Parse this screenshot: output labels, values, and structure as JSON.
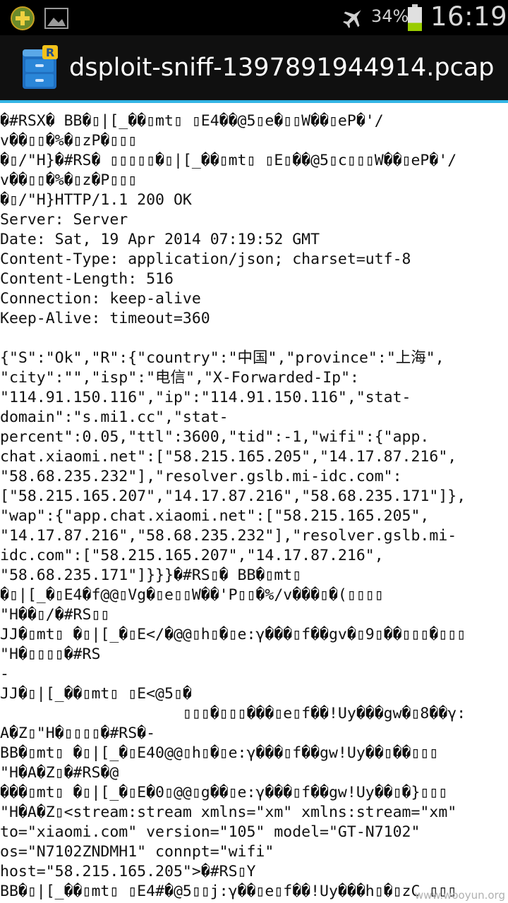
{
  "status_bar": {
    "battery_percent": "34%",
    "battery_level": 0.34,
    "time": "16:19",
    "icons": [
      "add-notification-icon",
      "image-notification-icon",
      "airplane-mode-icon",
      "battery-icon"
    ]
  },
  "title_bar": {
    "app_icon": "file-cabinet-icon",
    "title": "dsploit-sniff-1397891944914.pcap"
  },
  "content": {
    "lines": [
      "�#RSX� BB�▯|[_��▯mt▯ ▯E4��@5▯e�▯▯W��▯eP�'/",
      "v��▯▯�%�▯zP�▯▯▯",
      "�▯/\"H}�#RS� ▯▯▯▯▯�▯|[_��▯mt▯ ▯E▯��@5▯c▯▯▯W��▯eP�'/",
      "v��▯▯�%�▯z�P▯▯▯",
      "�▯/\"H}HTTP/1.1 200 OK",
      "Server: Server",
      "Date: Sat, 19 Apr 2014 07:19:52 GMT",
      "Content-Type: application/json; charset=utf-8",
      "Content-Length: 516",
      "Connection: keep-alive",
      "Keep-Alive: timeout=360",
      "",
      "{\"S\":\"Ok\",\"R\":{\"country\":\"中国\",\"province\":\"上海\",",
      "\"city\":\"\",\"isp\":\"电信\",\"X-Forwarded-Ip\":",
      "\"114.91.150.116\",\"ip\":\"114.91.150.116\",\"stat-",
      "domain\":\"s.mi1.cc\",\"stat-",
      "percent\":0.05,\"ttl\":3600,\"tid\":-1,\"wifi\":{\"app.",
      "chat.xiaomi.net\":[\"58.215.165.205\",\"14.17.87.216\",",
      "\"58.68.235.232\"],\"resolver.gslb.mi-idc.com\":",
      "[\"58.215.165.207\",\"14.17.87.216\",\"58.68.235.171\"]},",
      "\"wap\":{\"app.chat.xiaomi.net\":[\"58.215.165.205\",",
      "\"14.17.87.216\",\"58.68.235.232\"],\"resolver.gslb.mi-",
      "idc.com\":[\"58.215.165.207\",\"14.17.87.216\",",
      "\"58.68.235.171\"]}}}�#RS▯� BB�▯mt▯",
      "�▯|[_�▯E4�f@@▯Vg�▯e▯▯W��'P▯▯�%/v���▯�(▯▯▯▯",
      "\"H��▯/�#RS▯▯",
      "JJ�▯mt▯ �▯|[_�▯E</�@@▯h▯�▯e:γ���▯f��gv�▯9▯��▯▯▯�▯▯▯",
      "\"H�▯▯▯▯�#RS",
      "-",
      "JJ�▯|[_��▯mt▯ ▯E<@5▯�",
      "                    ▯▯▯�▯▯▯���▯e▯f��!Uy���gw�▯8��γ:",
      "A�Z▯\"H�▯▯▯▯�#RS�-",
      "BB�▯mt▯ �▯|[_�▯E40@@▯h▯�▯e:γ���▯f��gw!Uy��▯��▯▯▯",
      "\"H�A�Z▯�#RS�@",
      "���▯mt▯ �▯|[_�▯E�0▯@@▯g��▯e:γ���▯f��gw!Uy��▯�}▯▯▯",
      "\"H�A�Z▯<stream:stream xmlns=\"xm\" xmlns:stream=\"xm\"",
      "to=\"xiaomi.com\" version=\"105\" model=\"GT-N7102\"",
      "os=\"N7102ZNDMH1\" connpt=\"wifi\"",
      "host=\"58.215.165.205\">�#RS▯Y",
      "BB�▯|[_��▯mt▯ ▯E4#�@5▯▯j:γ��▯e▯f��!Uy���h▯�▯zC ▯▯▯"
    ]
  },
  "watermark": "www.wooyun.org"
}
